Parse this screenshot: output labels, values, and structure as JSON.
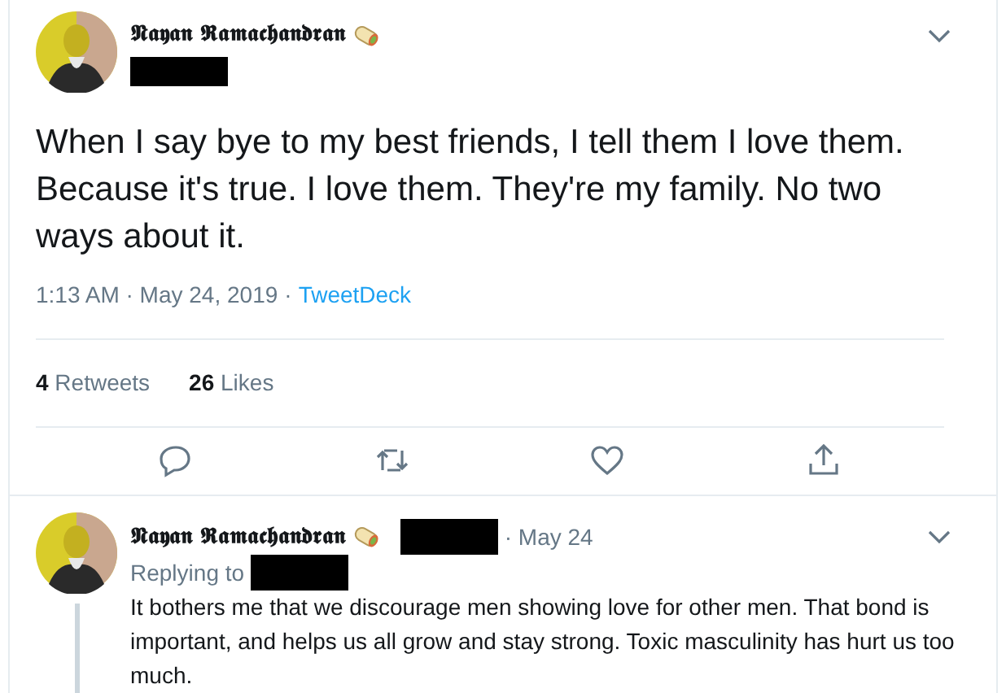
{
  "tweet": {
    "author": "𝕹𝖆𝖞𝖆𝖓 𝕽𝖆𝖒𝖆𝖈𝖍𝖆𝖓𝖉𝖗𝖆𝖓",
    "text": "When I say bye to my best friends, I tell them I love them. Because it's true. I love them. They're my family. No two ways about it.",
    "time": "1:13 AM · May 24, 2019",
    "separator": "·",
    "source": "TweetDeck",
    "stats": [
      {
        "count": "4",
        "label": "Retweets"
      },
      {
        "count": "26",
        "label": "Likes"
      }
    ],
    "actions": [
      {
        "kind": "reply"
      },
      {
        "kind": "retweet"
      },
      {
        "kind": "like"
      },
      {
        "kind": "share"
      }
    ]
  },
  "reply": {
    "author": "𝕹𝖆𝖞𝖆𝖓 𝕽𝖆𝖒𝖆𝖈𝖍𝖆𝖓𝖉𝖗𝖆𝖓",
    "date": "· May 24",
    "replying_to": "Replying to",
    "text": "It bothers me that we discourage men showing love for other men. That bond is important, and helps us all grow and stay strong. Toxic masculinity has hurt us too much."
  }
}
